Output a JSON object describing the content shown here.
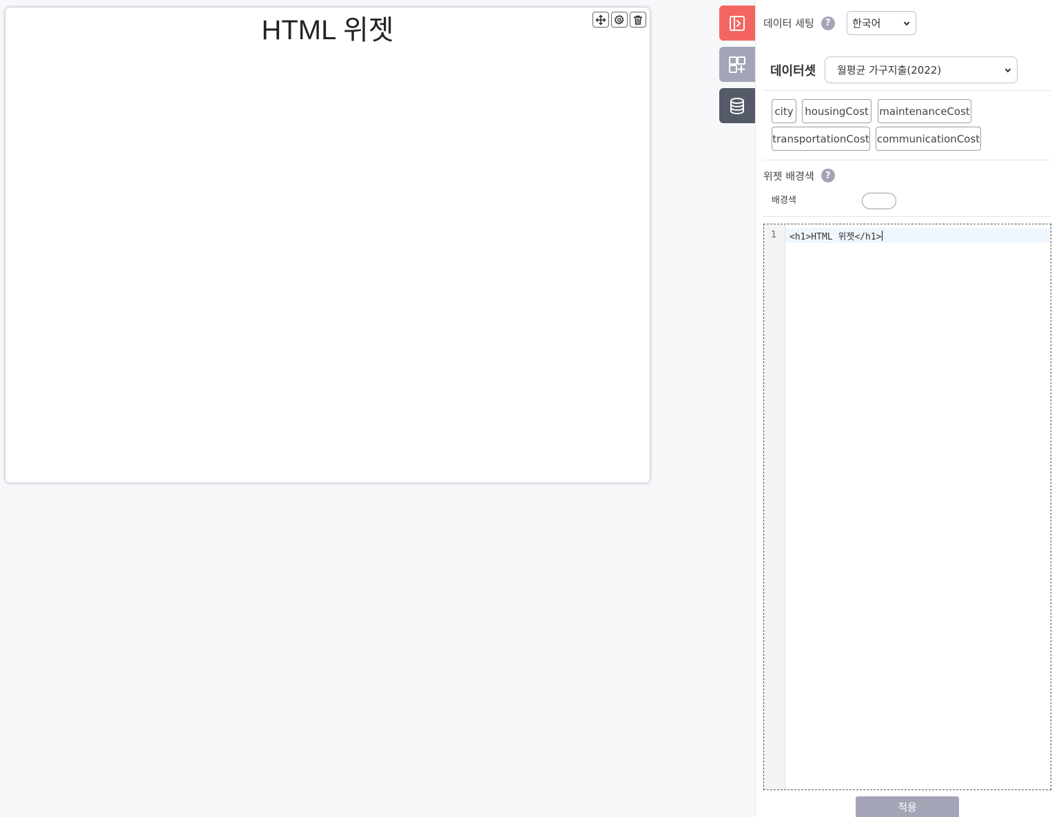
{
  "widget": {
    "title": "HTML 위젯",
    "tools": [
      "move-icon",
      "gear-icon",
      "trash-icon"
    ]
  },
  "side_tabs": [
    {
      "icon": "panel-toggle-icon",
      "color": "#f4655f"
    },
    {
      "icon": "add-widget-icon",
      "color": "#a3a5b6"
    },
    {
      "icon": "database-icon",
      "color": "#555a68"
    }
  ],
  "panel": {
    "data_setting_label": "데이터 세팅",
    "language_value": "한국어",
    "dataset_label": "데이터셋",
    "dataset_value": "월평균 가구지출(2022)",
    "fields": [
      "city",
      "housingCost",
      "maintenanceCost",
      "transportationCost",
      "communicationCost"
    ],
    "widget_bg_label": "위젯 배경색",
    "bg_color_label": "배경색",
    "help_glyph": "?",
    "editor": {
      "line_number": "1",
      "code": "<h1>HTML 위젯</h1>"
    },
    "apply_label": "적용"
  },
  "colors": {
    "accent_red": "#f4655f",
    "muted_gray": "#a3a5b6",
    "dark_slate": "#555a68"
  }
}
